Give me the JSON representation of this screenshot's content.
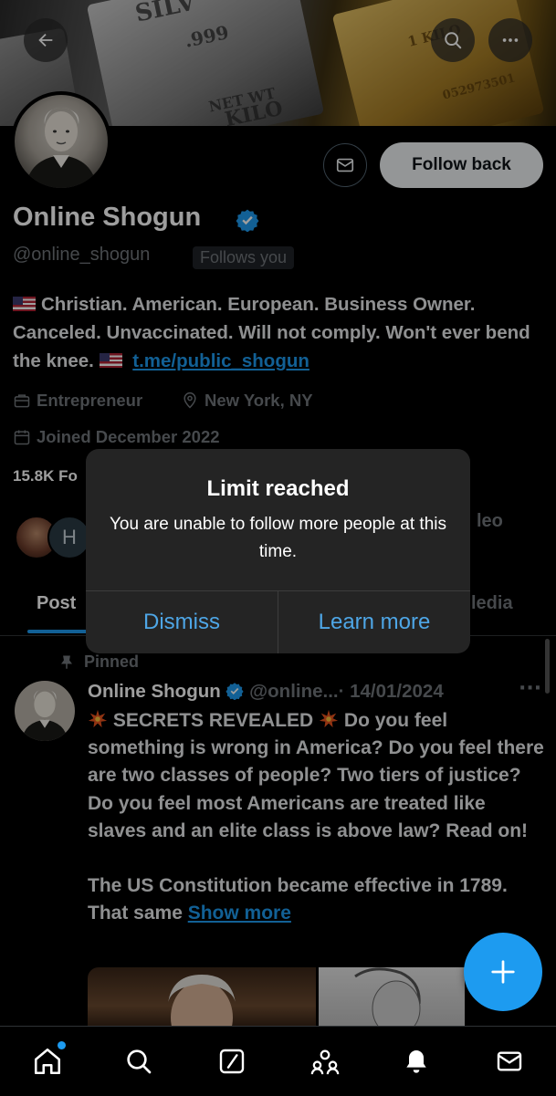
{
  "header": {
    "back_icon": "arrow-left-icon",
    "search_icon": "search-icon",
    "more_icon": "more-horizontal-icon",
    "banner_stamps": [
      "SILV",
      ".999",
      "NET WT",
      "KILO",
      "1 KILO",
      "052973501"
    ]
  },
  "profile": {
    "name": "Online Shogun",
    "handle": "@online_shogun",
    "follows_you": "Follows you",
    "follow_back_label": "Follow back",
    "bio_text": "Christian. American. European. Business Owner. Canceled. Unvaccinated. Will not comply. Won't ever bend the knee.",
    "bio_link": "t.me/public_shogun",
    "occupation": "Entrepreneur",
    "location": "New York, NY",
    "joined": "Joined December 2022",
    "stats_visible": "15.8K Fo",
    "followers_initial": "H",
    "tab_peek_right": "leo"
  },
  "tabs": [
    {
      "label": "Post",
      "active": true
    },
    {
      "label": "ledia",
      "active": false
    }
  ],
  "post": {
    "pinned_label": "Pinned",
    "author": "Online Shogun",
    "handle": "@online...",
    "date": "· 14/01/2024",
    "more": "···",
    "headline": "SECRETS REVEALED",
    "body1": "Do you feel something is wrong in America? Do you feel there are two classes of people? Two tiers of justice? Do you feel most Americans are treated like slaves and an elite class is above law? Read on!",
    "body2": "The US Constitution became effective in 1789. That same",
    "show_more": "Show more"
  },
  "modal": {
    "title": "Limit reached",
    "message": "You are unable to follow more people at this time.",
    "dismiss": "Dismiss",
    "learn_more": "Learn more"
  },
  "nav": [
    "home-icon",
    "search-icon",
    "grok-icon",
    "communities-icon",
    "notifications-icon",
    "messages-icon"
  ],
  "colors": {
    "accent": "#1d9bf0",
    "background": "#000000",
    "modal_bg": "#242424",
    "modal_button": "#4ea6e6",
    "muted": "#71767b"
  }
}
